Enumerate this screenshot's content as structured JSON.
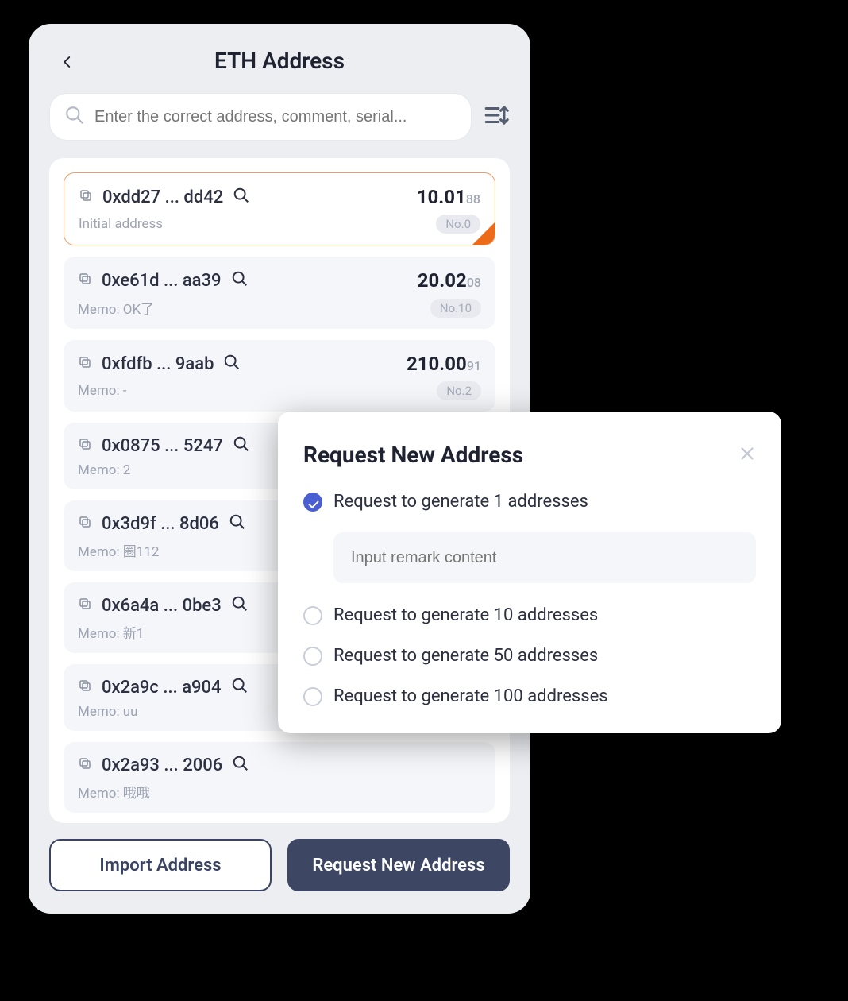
{
  "header": {
    "title": "ETH Address"
  },
  "search": {
    "placeholder": "Enter the correct address, comment, serial..."
  },
  "addresses": [
    {
      "addr": "0xdd27 ... dd42",
      "balance_main": "10.01",
      "balance_sub": "88",
      "memo": "Initial address",
      "badge": "No.0",
      "selected": true
    },
    {
      "addr": "0xe61d ... aa39",
      "balance_main": "20.02",
      "balance_sub": "08",
      "memo": "Memo: OK了",
      "badge": "No.10",
      "selected": false
    },
    {
      "addr": "0xfdfb ... 9aab",
      "balance_main": "210.00",
      "balance_sub": "91",
      "memo": "Memo: -",
      "badge": "No.2",
      "selected": false
    },
    {
      "addr": "0x0875 ... 5247",
      "balance_main": "",
      "balance_sub": "",
      "memo": "Memo: 2",
      "badge": "",
      "selected": false
    },
    {
      "addr": "0x3d9f ... 8d06",
      "balance_main": "",
      "balance_sub": "",
      "memo": "Memo: 圈112",
      "badge": "",
      "selected": false
    },
    {
      "addr": "0x6a4a ... 0be3",
      "balance_main": "",
      "balance_sub": "",
      "memo": "Memo: 新1",
      "badge": "",
      "selected": false
    },
    {
      "addr": "0x2a9c ... a904",
      "balance_main": "",
      "balance_sub": "",
      "memo": "Memo: uu",
      "badge": "",
      "selected": false
    },
    {
      "addr": "0x2a93 ... 2006",
      "balance_main": "",
      "balance_sub": "",
      "memo": "Memo: 哦哦",
      "badge": "",
      "selected": false
    }
  ],
  "buttons": {
    "import": "Import Address",
    "request": "Request New Address"
  },
  "modal": {
    "title": "Request New Address",
    "remark_placeholder": "Input remark content",
    "options": [
      {
        "label": "Request to generate 1 addresses",
        "checked": true
      },
      {
        "label": "Request to generate 10 addresses",
        "checked": false
      },
      {
        "label": "Request to generate 50 addresses",
        "checked": false
      },
      {
        "label": "Request to generate 100 addresses",
        "checked": false
      }
    ]
  }
}
